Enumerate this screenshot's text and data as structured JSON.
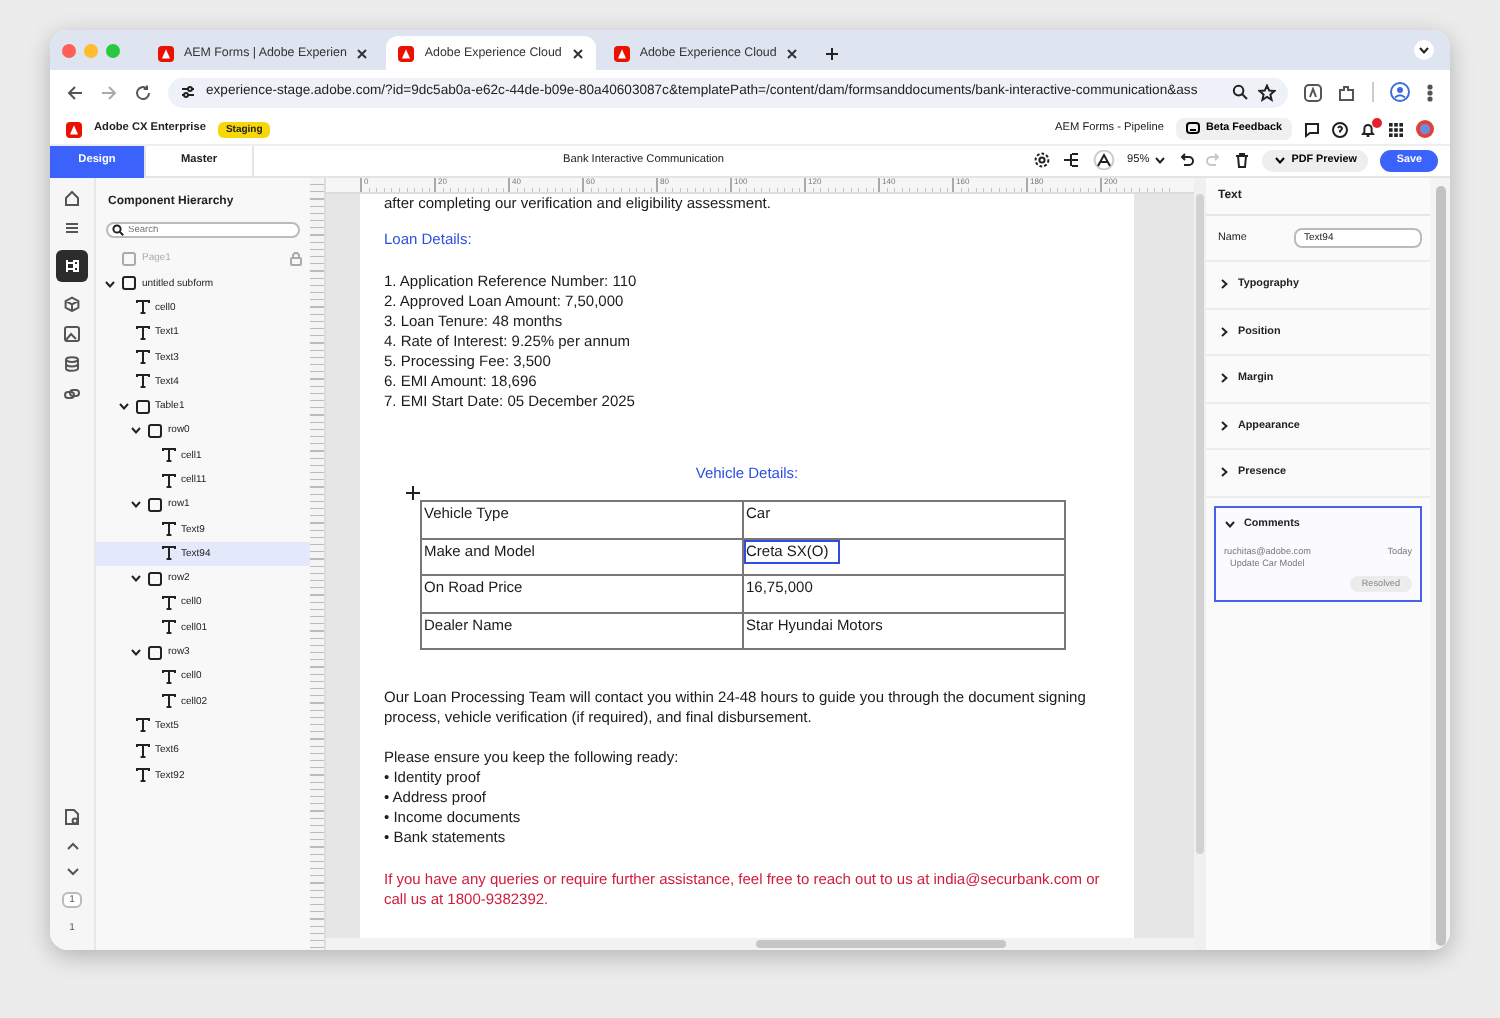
{
  "browser": {
    "tabs": [
      {
        "title": "AEM Forms | Adobe Experien",
        "selected": false
      },
      {
        "title": "Adobe Experience Cloud",
        "selected": true
      },
      {
        "title": "Adobe Experience Cloud",
        "selected": false
      }
    ],
    "url": "experience-stage.adobe.com/?id=9dc5ab0a-e62c-44de-b09e-80a40603087c&templatePath=/content/dam/formsanddocuments/bank-interactive-communication&ass"
  },
  "app_header": {
    "product": "Adobe CX Enterprise",
    "environment_badge": "Staging",
    "program": "AEM Forms - Pipeline",
    "feedback_button": "Beta Feedback"
  },
  "editor_bar": {
    "tabs": [
      {
        "label": "Design",
        "selected": true
      },
      {
        "label": "Master",
        "selected": false
      }
    ],
    "document_title": "Bank Interactive Communication",
    "zoom": "95%",
    "redo_disabled": true,
    "preview_button": "PDF Preview",
    "save_button": "Save"
  },
  "hierarchy": {
    "title": "Component Hierarchy",
    "search_placeholder": "Search",
    "items": [
      {
        "label": "Page1",
        "kind": "group",
        "selected": false,
        "locked": true
      },
      {
        "label": "untitled subform",
        "kind": "group",
        "selected": false,
        "locked": false,
        "expanded": true,
        "children": [
          {
            "label": "cell0",
            "kind": "text",
            "selected": false,
            "locked": false
          },
          {
            "label": "Text1",
            "kind": "text",
            "selected": false,
            "locked": false
          },
          {
            "label": "Text3",
            "kind": "text",
            "selected": false,
            "locked": false
          },
          {
            "label": "Text4",
            "kind": "text",
            "selected": false,
            "locked": false
          },
          {
            "label": "Table1",
            "kind": "group",
            "selected": false,
            "locked": false,
            "expanded": true,
            "children": [
              {
                "label": "row0",
                "kind": "group",
                "selected": false,
                "locked": false,
                "expanded": true,
                "children": [
                  {
                    "label": "cell1",
                    "kind": "text",
                    "selected": false,
                    "locked": false
                  },
                  {
                    "label": "cell11",
                    "kind": "text",
                    "selected": false,
                    "locked": false
                  }
                ]
              },
              {
                "label": "row1",
                "kind": "group",
                "selected": false,
                "locked": false,
                "expanded": true,
                "children": [
                  {
                    "label": "Text9",
                    "kind": "text",
                    "selected": false,
                    "locked": false
                  },
                  {
                    "label": "Text94",
                    "kind": "text",
                    "selected": true,
                    "locked": false
                  }
                ]
              },
              {
                "label": "row2",
                "kind": "group",
                "selected": false,
                "locked": false,
                "expanded": true,
                "children": [
                  {
                    "label": "cell0",
                    "kind": "text",
                    "selected": false,
                    "locked": false
                  },
                  {
                    "label": "cell01",
                    "kind": "text",
                    "selected": false,
                    "locked": false
                  }
                ]
              },
              {
                "label": "row3",
                "kind": "group",
                "selected": false,
                "locked": false,
                "expanded": true,
                "children": [
                  {
                    "label": "cell0",
                    "kind": "text",
                    "selected": false,
                    "locked": false
                  },
                  {
                    "label": "cell02",
                    "kind": "text",
                    "selected": false,
                    "locked": false
                  }
                ]
              }
            ]
          },
          {
            "label": "Text5",
            "kind": "text",
            "selected": false,
            "locked": false
          },
          {
            "label": "Text6",
            "kind": "text",
            "selected": false,
            "locked": false
          },
          {
            "label": "Text92",
            "kind": "text",
            "selected": false,
            "locked": false
          }
        ]
      }
    ]
  },
  "ruler": {
    "labels": [
      "0",
      "20",
      "40",
      "60",
      "80",
      "100",
      "120",
      "140",
      "160",
      "180",
      "200"
    ]
  },
  "document": {
    "cut_line": "after completing our verification and eligibility assessment.",
    "loan_heading": "Loan Details:",
    "loan_items": [
      "1. Application Reference Number: 110",
      "2. Approved Loan Amount: 7,50,000",
      "3. Loan Tenure: 48 months",
      "4. Rate of Interest: 9.25% per annum",
      "5. Processing Fee: 3,500",
      "6. EMI Amount: 18,696",
      "7. EMI Start Date: 05 December 2025"
    ],
    "vehicle_heading": "Vehicle Details:",
    "vehicle_table": {
      "rows": [
        {
          "column_1": "Vehicle Type",
          "column_2": "Car",
          "selected": false
        },
        {
          "column_1": "Make and Model",
          "column_2": "Creta SX(O)",
          "selected": true
        },
        {
          "column_1": "On Road Price",
          "column_2": "16,75,000",
          "selected": false
        },
        {
          "column_1": "Dealer Name",
          "column_2": "Star Hyundai Motors",
          "selected": false
        }
      ]
    },
    "contact_paragraph": "Our Loan Processing Team will contact you within 24-48 hours to guide you through the document signing process, vehicle verification (if required), and final disbursement.",
    "checklist_intro": "Please ensure you keep the following ready:",
    "checklist": [
      "• Identity proof",
      "• Address proof",
      "• Income documents",
      "• Bank statements"
    ],
    "support_note": "If you have any queries or require further assistance, feel free to reach out to us at india@securbank.com or call us at 1800-9382392."
  },
  "pager": {
    "current_page": "1",
    "page_count": "1"
  },
  "properties": {
    "title": "Text",
    "name_label": "Name",
    "name_value": "Text94",
    "sections": [
      {
        "label": "Typography",
        "expanded": false
      },
      {
        "label": "Position",
        "expanded": false
      },
      {
        "label": "Margin",
        "expanded": false
      },
      {
        "label": "Appearance",
        "expanded": false
      },
      {
        "label": "Presence",
        "expanded": false
      },
      {
        "label": "Comments",
        "expanded": true,
        "comments": [
          {
            "author": "ruchitas@adobe.com",
            "time": "Today",
            "text": "Update Car Model",
            "resolve_button": "Resolved",
            "resolve_disabled": true
          }
        ]
      }
    ]
  }
}
